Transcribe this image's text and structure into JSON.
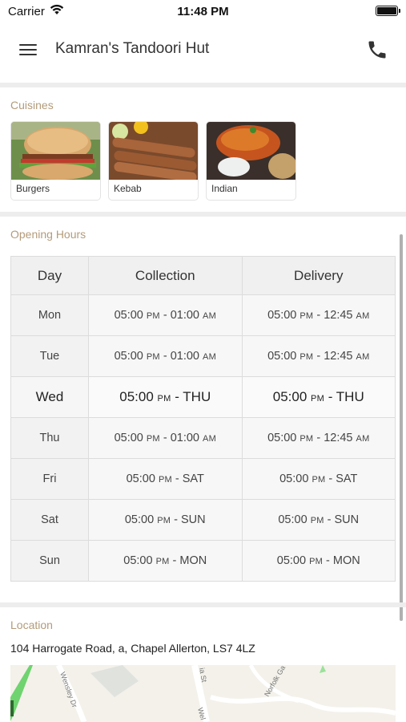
{
  "status_bar": {
    "carrier": "Carrier",
    "time": "11:48 PM"
  },
  "header": {
    "title": "Kamran's Tandoori Hut"
  },
  "cuisines": {
    "title": "Cuisines",
    "items": [
      {
        "label": "Burgers"
      },
      {
        "label": "Kebab"
      },
      {
        "label": "Indian"
      }
    ]
  },
  "opening_hours": {
    "title": "Opening Hours",
    "columns": [
      "Day",
      "Collection",
      "Delivery"
    ],
    "rows": [
      {
        "day": "Mon",
        "collection": {
          "from": "05:00",
          "from_ampm": "PM",
          "sep": "-",
          "to": "01:00",
          "to_ampm": "AM"
        },
        "delivery": {
          "from": "05:00",
          "from_ampm": "PM",
          "sep": "-",
          "to": "12:45",
          "to_ampm": "AM"
        }
      },
      {
        "day": "Tue",
        "collection": {
          "from": "05:00",
          "from_ampm": "PM",
          "sep": "-",
          "to": "01:00",
          "to_ampm": "AM"
        },
        "delivery": {
          "from": "05:00",
          "from_ampm": "PM",
          "sep": "-",
          "to": "12:45",
          "to_ampm": "AM"
        }
      },
      {
        "day": "Wed",
        "collection": {
          "from": "05:00",
          "from_ampm": "PM",
          "sep": "-",
          "to": "THU",
          "to_ampm": ""
        },
        "delivery": {
          "from": "05:00",
          "from_ampm": "PM",
          "sep": "-",
          "to": "THU",
          "to_ampm": ""
        }
      },
      {
        "day": "Thu",
        "collection": {
          "from": "05:00",
          "from_ampm": "PM",
          "sep": "-",
          "to": "01:00",
          "to_ampm": "AM"
        },
        "delivery": {
          "from": "05:00",
          "from_ampm": "PM",
          "sep": "-",
          "to": "12:45",
          "to_ampm": "AM"
        }
      },
      {
        "day": "Fri",
        "collection": {
          "from": "05:00",
          "from_ampm": "PM",
          "sep": "-",
          "to": "SAT",
          "to_ampm": ""
        },
        "delivery": {
          "from": "05:00",
          "from_ampm": "PM",
          "sep": "-",
          "to": "SAT",
          "to_ampm": ""
        }
      },
      {
        "day": "Sat",
        "collection": {
          "from": "05:00",
          "from_ampm": "PM",
          "sep": "-",
          "to": "SUN",
          "to_ampm": ""
        },
        "delivery": {
          "from": "05:00",
          "from_ampm": "PM",
          "sep": "-",
          "to": "SUN",
          "to_ampm": ""
        }
      },
      {
        "day": "Sun",
        "collection": {
          "from": "05:00",
          "from_ampm": "PM",
          "sep": "-",
          "to": "MON",
          "to_ampm": ""
        },
        "delivery": {
          "from": "05:00",
          "from_ampm": "PM",
          "sep": "-",
          "to": "MON",
          "to_ampm": ""
        }
      }
    ],
    "highlighted_day": "Wed"
  },
  "location": {
    "title": "Location",
    "address": "104 Harrogate Road, a, Chapel Allerton, LS7 4LZ",
    "map_labels": [
      "Wensley Dr",
      "ia St",
      "Norfolk Ga",
      "Wel"
    ]
  },
  "colors": {
    "section_title": "#b39b7a",
    "divider": "#ededed",
    "map_green": "#6fd36f"
  },
  "icons": {
    "menu": "hamburger-icon",
    "call": "phone-icon",
    "wifi": "wifi-icon",
    "battery": "battery-icon"
  }
}
